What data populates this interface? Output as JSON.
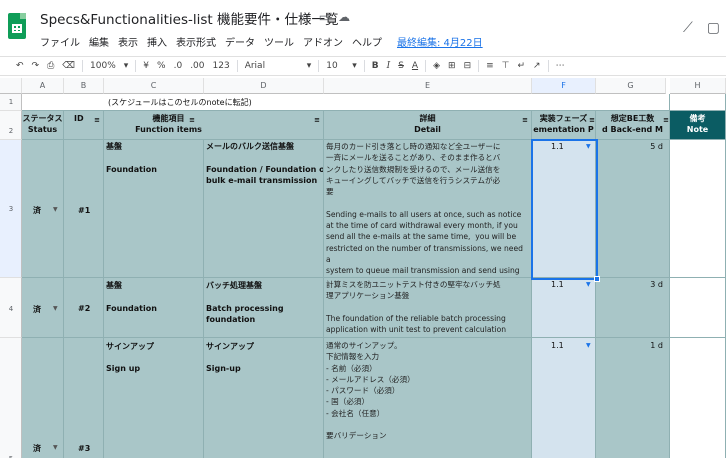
{
  "app": {
    "title": "Specs&Functionalities-list 機能要件・仕様一覧",
    "title_icons": [
      "star-icon",
      "folder-icon",
      "cloud-icon"
    ],
    "menu": [
      "ファイル",
      "編集",
      "表示",
      "挿入",
      "表示形式",
      "データ",
      "ツール",
      "アドオン",
      "ヘルプ"
    ],
    "last_edit": "最終編集: 4月22日",
    "brand_color": "#0f9d58"
  },
  "toolbar": {
    "undo": "↶",
    "redo": "↷",
    "print": "⎙",
    "paint": "⌫",
    "zoom": "100%",
    "currency": "¥",
    "percent": "%",
    "dec_less": ".0",
    "dec_more": ".00",
    "more_formats": "123",
    "font": "Arial",
    "font_size": "10",
    "bold": "B",
    "italic": "I",
    "strike": "S",
    "text_color": "A",
    "more": "⋯"
  },
  "columns": [
    "A",
    "B",
    "C",
    "D",
    "E",
    "F",
    "G",
    "H"
  ],
  "rows": {
    "r1": "1",
    "r2": "2",
    "r3": "3",
    "r4": "4",
    "r5": "5"
  },
  "row1_note": "(スケジュールはこのセルのnoteに転記)",
  "headers": {
    "status_jp": "ステータス",
    "status_en": "Status",
    "id": "ID",
    "func_jp": "機能項目",
    "func_en": "Function items",
    "detail_jp": "詳細",
    "detail_en": "Detail",
    "impl_jp": "実装フェーズ",
    "impl_en": "ementation P",
    "be_jp": "想定BE工数",
    "be_en": "d Back-end M",
    "note_jp": "備考",
    "note_en": "Note"
  },
  "data_rows": [
    {
      "status": "済",
      "id": "#1",
      "cat_jp": "基盤",
      "cat_en": "Foundation",
      "name_jp": "メールのバルク送信基盤",
      "name_en_1": "Foundation / Foundation of",
      "name_en_2": "bulk e-mail transmission",
      "detail": "毎月のカード引き落とし時の通知など全ユーザーに\n一斉にメールを送ることがあり、そのまま作るとバ\nンクしたり送信数規制を受けるので、メール送信を\nキューイングしてバッチで送信を行うシステムが必\n要\n\nSending e-mails to all users at once, such as notice\nat the time of card withdrawal every month, if you\nsend all the e-mails at the same time,  you will be\nrestricted on the number of transmissions, we need a\nsystem to queue mail transmission and send using\nbatch processing.",
      "phase": "1.1",
      "be": "5 d"
    },
    {
      "status": "済",
      "id": "#2",
      "cat_jp": "基盤",
      "cat_en": "Foundation",
      "name_jp": "バッチ処理基盤",
      "name_en_1": "Batch processing",
      "name_en_2": "foundation",
      "detail": "計算ミスを防ユニットテスト付きの堅牢なバッチ処\n理アプリケーション基盤\n\nThe foundation of the reliable batch processing\napplication with unit test to prevent calculation errors.",
      "phase": "1.1",
      "be": "3 d"
    },
    {
      "status": "済",
      "id": "#3",
      "cat_jp": "サインアップ",
      "cat_en": "Sign up",
      "name_jp": "サインアップ",
      "name_en_1": "Sign-up",
      "name_en_2": "",
      "detail": "通常のサインアップ。\n下記情報を入力\n- 名前（必須）\n- メールアドレス（必須）\n- パスワード（必須）\n- 国（必須）\n- 会社名（任意）\n\n要バリデーション",
      "phase": "1.1",
      "be": "1 d"
    }
  ],
  "colors": {
    "row_fill": "#a9c6c8",
    "header_fill": "#0b5c63",
    "selected_column": "#d4e3ee",
    "selection_border": "#1a73e8"
  }
}
